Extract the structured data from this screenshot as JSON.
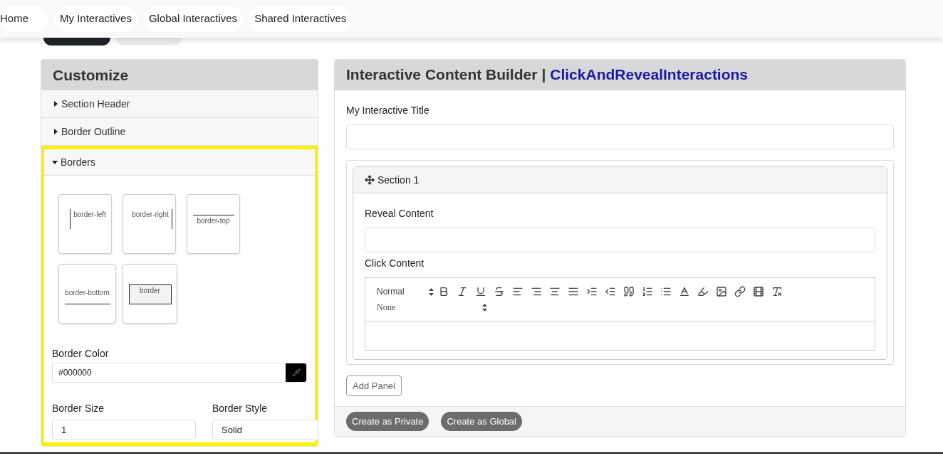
{
  "nav": [
    "Home",
    "My Interactives",
    "Global Interactives",
    "Shared Interactives"
  ],
  "customize": {
    "title": "Customize",
    "sections": [
      {
        "label": "Section Header",
        "expanded": false,
        "highlighted": false
      },
      {
        "label": "Border Outline",
        "expanded": false,
        "highlighted": false
      },
      {
        "label": "Borders",
        "expanded": true,
        "highlighted": true
      }
    ],
    "border_options": [
      {
        "label": "border-left",
        "kind": "left"
      },
      {
        "label": "border-right",
        "kind": "right"
      },
      {
        "label": "border-top",
        "kind": "top"
      },
      {
        "label": "border-bottom",
        "kind": "bottom"
      },
      {
        "label": "border",
        "kind": "all"
      }
    ],
    "border_color": {
      "label": "Border Color",
      "value": "#000000"
    },
    "border_size": {
      "label": "Border Size",
      "value": "1"
    },
    "border_style": {
      "label": "Border Style",
      "value": "Solid"
    }
  },
  "builder": {
    "title": "Interactive Content Builder",
    "separator": "|",
    "name": "ClickAndRevealInteractions",
    "title_field": {
      "label": "My Interactive Title"
    },
    "sections": [
      {
        "title": "Section 1",
        "reveal_label": "Reveal Content",
        "click_label": "Click Content",
        "format": "Normal",
        "font": "None"
      }
    ],
    "add_panel": "Add Panel",
    "footer_buttons": [
      "Create as Private",
      "Create as Global"
    ]
  }
}
